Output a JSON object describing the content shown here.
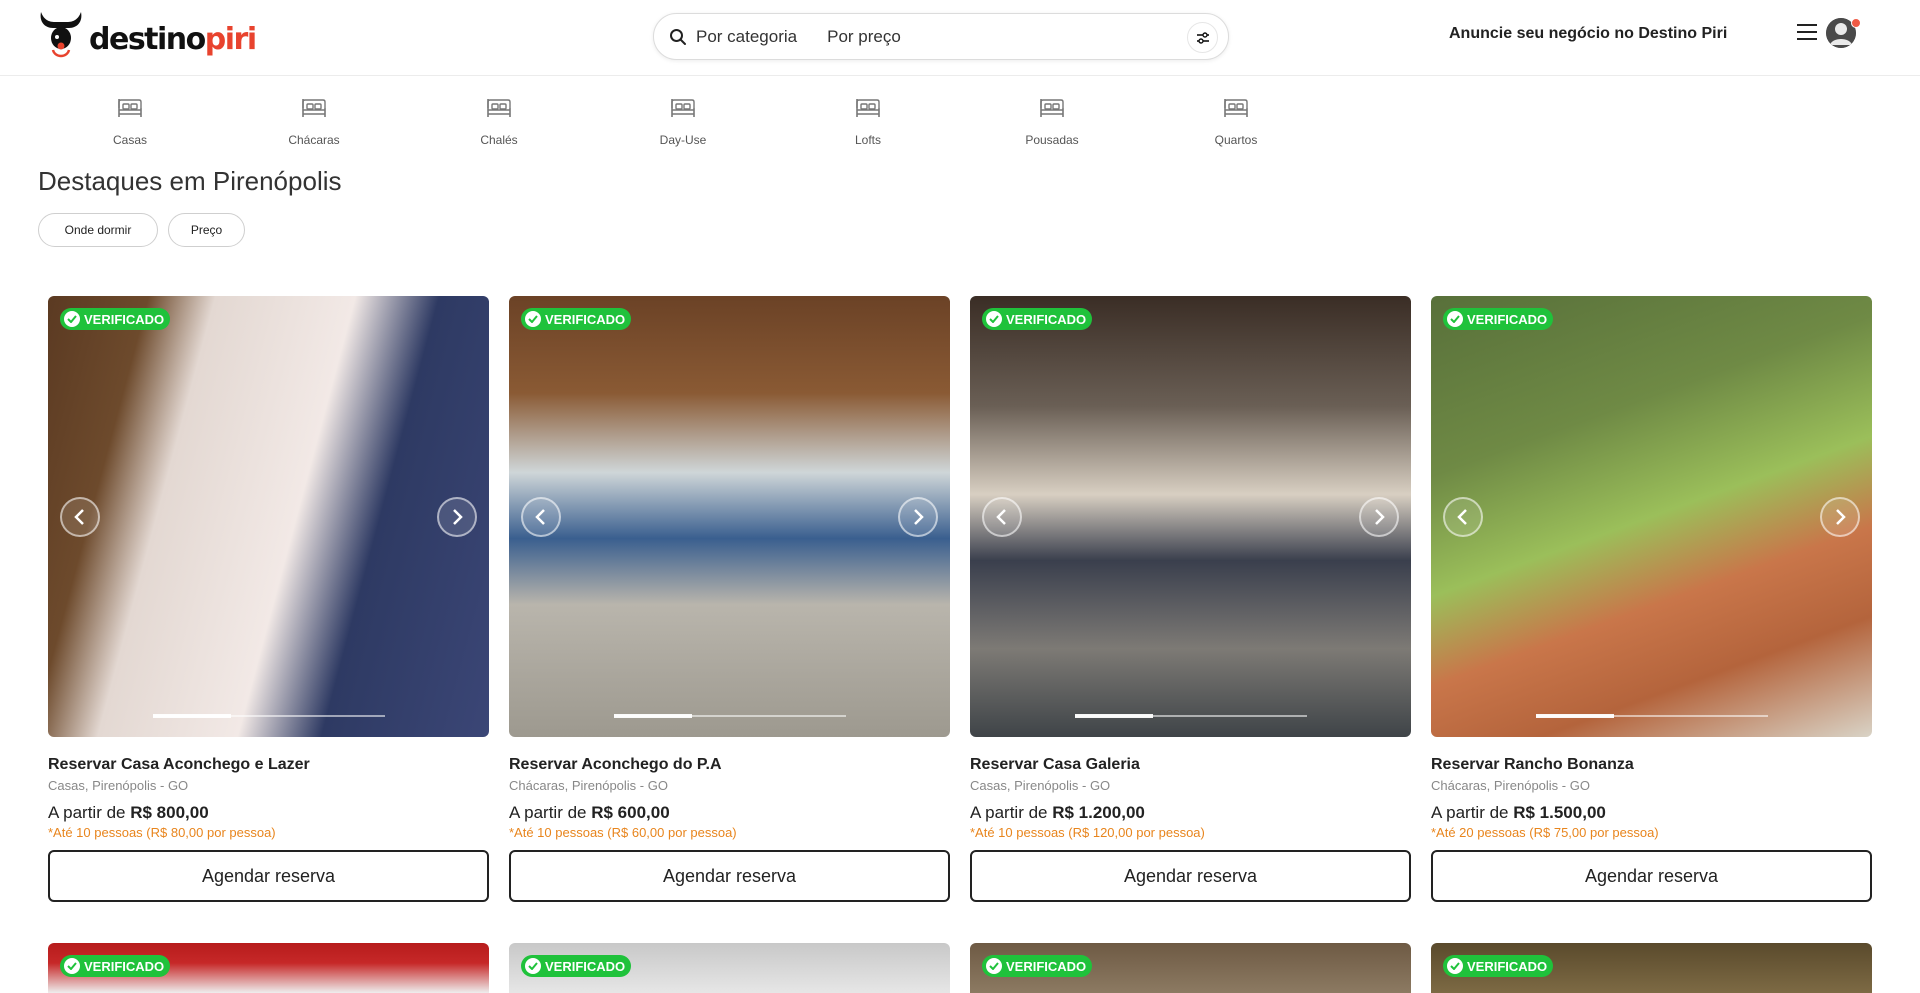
{
  "brand": {
    "name_dark": "destino",
    "name_red": "piri"
  },
  "search": {
    "category": "Por categoria",
    "price": "Por preço"
  },
  "header": {
    "advertise": "Anuncie seu negócio no Destino Piri"
  },
  "categories": [
    {
      "label": "Casas",
      "icon": "bed-icon"
    },
    {
      "label": "Chácaras",
      "icon": "bed-icon"
    },
    {
      "label": "Chalés",
      "icon": "bed-icon"
    },
    {
      "label": "Day-Use",
      "icon": "bed-icon"
    },
    {
      "label": "Lofts",
      "icon": "bed-icon"
    },
    {
      "label": "Pousadas",
      "icon": "bed-icon"
    },
    {
      "label": "Quartos",
      "icon": "bed-icon"
    }
  ],
  "section": {
    "title": "Destaques em Pirenópolis",
    "filters": [
      "Onde dormir",
      "Preço"
    ]
  },
  "listings": [
    {
      "badge": "VERIFICADO",
      "name": "Reservar Casa Aconchego e Lazer",
      "location": "Casas, Pirenópolis - GO",
      "price_prefix": "A partir de ",
      "price": "R$ 800,00",
      "note": "*Até 10 pessoas (R$ 80,00 por pessoa)",
      "cta": "Agendar reserva"
    },
    {
      "badge": "VERIFICADO",
      "name": "Reservar Aconchego do P.A",
      "location": "Chácaras, Pirenópolis - GO",
      "price_prefix": "A partir de ",
      "price": "R$ 600,00",
      "note": "*Até 10 pessoas (R$ 60,00 por pessoa)",
      "cta": "Agendar reserva"
    },
    {
      "badge": "VERIFICADO",
      "name": "Reservar Casa Galeria",
      "location": "Casas, Pirenópolis - GO",
      "price_prefix": "A partir de ",
      "price": "R$ 1.200,00",
      "note": "*Até 10 pessoas (R$ 120,00 por pessoa)",
      "cta": "Agendar reserva"
    },
    {
      "badge": "VERIFICADO",
      "name": "Reservar Rancho Bonanza",
      "location": "Chácaras, Pirenópolis - GO",
      "price_prefix": "A partir de ",
      "price": "R$ 1.500,00",
      "note": "*Até 20 pessoas (R$ 75,00 por pessoa)",
      "cta": "Agendar reserva"
    }
  ],
  "listings_row2": [
    {
      "badge": "VERIFICADO"
    },
    {
      "badge": "VERIFICADO"
    },
    {
      "badge": "VERIFICADO"
    },
    {
      "badge": "VERIFICADO"
    }
  ],
  "colors": {
    "brand_red": "#e8432e",
    "verified_green": "#1fc23b",
    "note_orange": "#e8851d"
  }
}
